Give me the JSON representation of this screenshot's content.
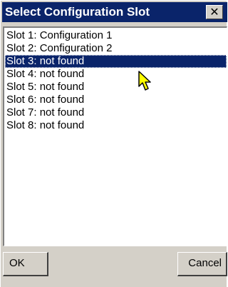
{
  "window": {
    "title": "Select Configuration Slot",
    "close_icon": "close-icon"
  },
  "slots": [
    {
      "label": "Slot 1: Configuration 1",
      "selected": false
    },
    {
      "label": "Slot 2: Configuration 2",
      "selected": false
    },
    {
      "label": "Slot 3: not found",
      "selected": true
    },
    {
      "label": "Slot 4: not found",
      "selected": false
    },
    {
      "label": "Slot 5: not found",
      "selected": false
    },
    {
      "label": "Slot 6: not found",
      "selected": false
    },
    {
      "label": "Slot 7: not found",
      "selected": false
    },
    {
      "label": "Slot 8: not found",
      "selected": false
    }
  ],
  "buttons": {
    "ok_label": "OK",
    "cancel_label": "Cancel"
  },
  "colors": {
    "titlebar": "#0a246a",
    "selection": "#0a246a",
    "face": "#d4d0c8"
  }
}
